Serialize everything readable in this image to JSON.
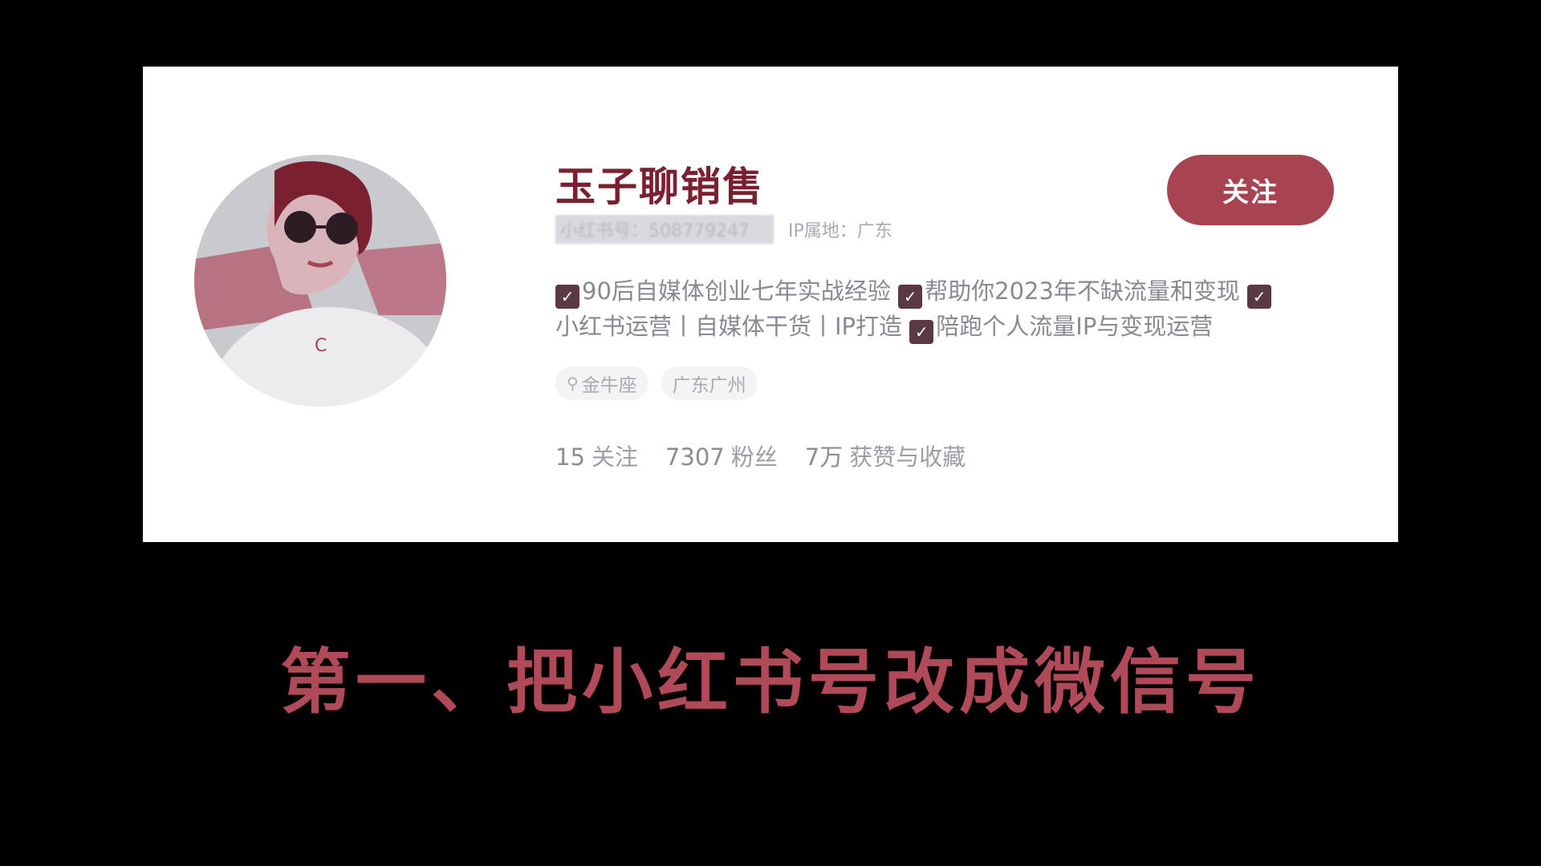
{
  "profile": {
    "username": "玉子聊销售",
    "account_id": "小红书号：508779247",
    "ip_location": "IP属地：广东",
    "follow_label": "关注",
    "bio": {
      "line1": [
        "90后自媒体创业七年实战经验",
        "帮助你2023年不缺流量和变现"
      ],
      "line2_lead": "小红书运营丨自媒体干货丨IP打造",
      "line2_tail": "陪跑个人流量IP与变现运营"
    },
    "tags": [
      "金牛座",
      "广东广州"
    ],
    "stats": [
      {
        "count": "15",
        "label": "关注"
      },
      {
        "count": "7307",
        "label": "粉丝"
      },
      {
        "count": "7万",
        "label": "获赞与收藏"
      }
    ]
  },
  "caption": "第一、把小红书号改成微信号",
  "icons": {
    "check": "✓",
    "pin": "⚲"
  },
  "colors": {
    "accent": "#a84452",
    "username": "#7a2030",
    "caption": "#b04a58",
    "background": "#000000"
  }
}
